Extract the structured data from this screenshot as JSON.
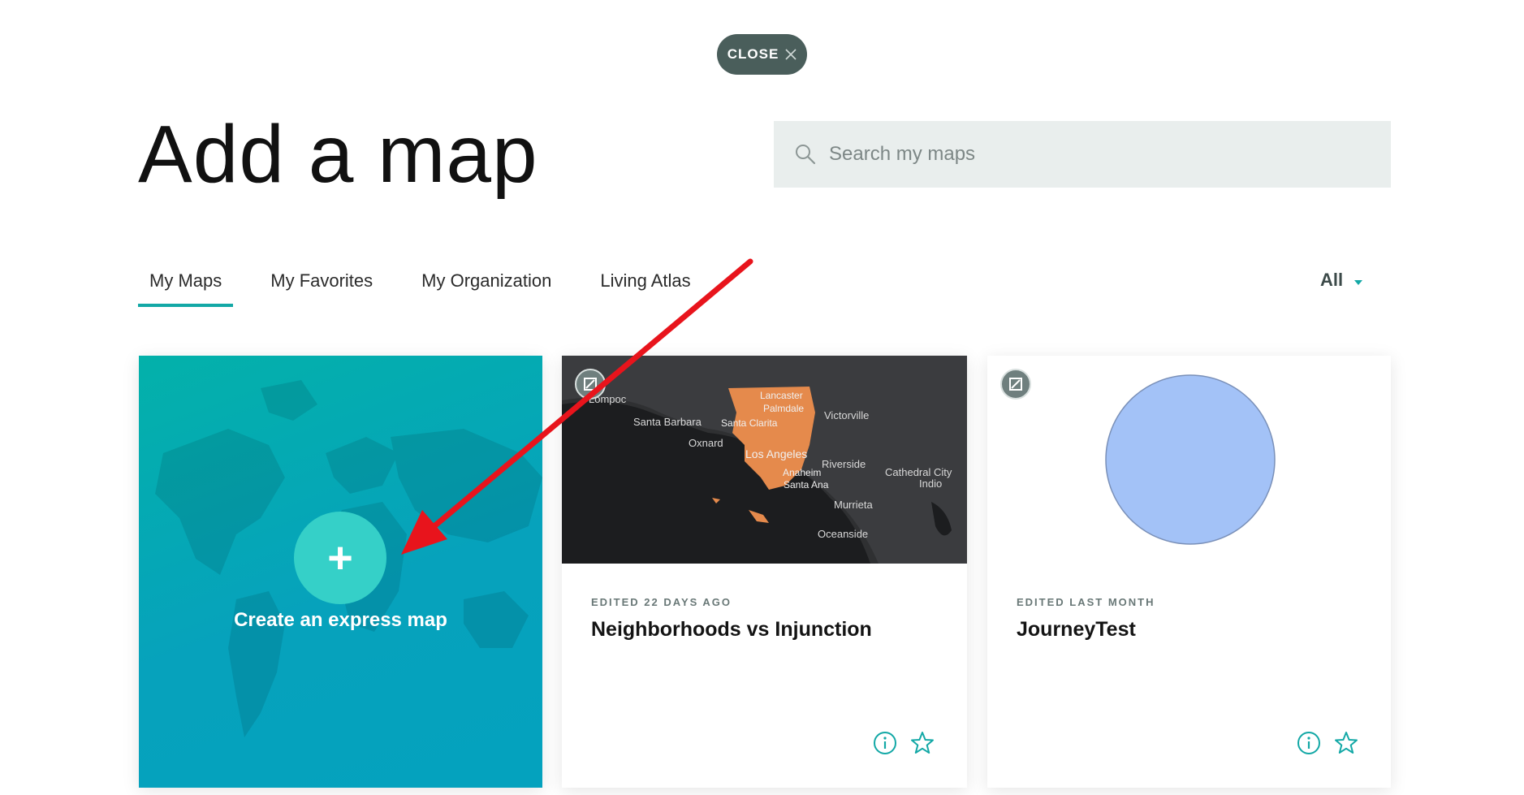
{
  "close_button": {
    "label": "CLOSE",
    "icon": "close-icon"
  },
  "page": {
    "title": "Add a map"
  },
  "search": {
    "placeholder": "Search my maps",
    "value": "",
    "icon": "search-icon"
  },
  "tabs": [
    {
      "label": "My Maps",
      "active": true
    },
    {
      "label": "My Favorites",
      "active": false
    },
    {
      "label": "My Organization",
      "active": false
    },
    {
      "label": "Living Atlas",
      "active": false
    }
  ],
  "filter": {
    "label": "All",
    "icon": "caret-down-icon"
  },
  "create_card": {
    "label": "Create an express map",
    "icon": "plus-icon"
  },
  "map_cards": [
    {
      "meta": "EDITED 22 DAYS AGO",
      "title": "Neighborhoods vs Injunction",
      "thumbnail_labels": [
        "Lompoc",
        "Santa Barbara",
        "Oxnard",
        "Santa Clarita",
        "Lancaster",
        "Palmdale",
        "Victorville",
        "Los Angeles",
        "Anaheim",
        "Riverside",
        "Santa Ana",
        "Cathedral City",
        "Indio",
        "Murrieta",
        "Oceanside"
      ]
    },
    {
      "meta": "EDITED LAST MONTH",
      "title": "JourneyTest"
    }
  ],
  "colors": {
    "accent": "#13a8a6",
    "close_bg": "#4a5e5b",
    "search_bg": "#e9eeed",
    "create_card_bg": "#06a2bc",
    "plus_circle": "#35d0c8",
    "annotation_arrow": "#e8141c",
    "circle_fill": "#a3c2f7"
  }
}
